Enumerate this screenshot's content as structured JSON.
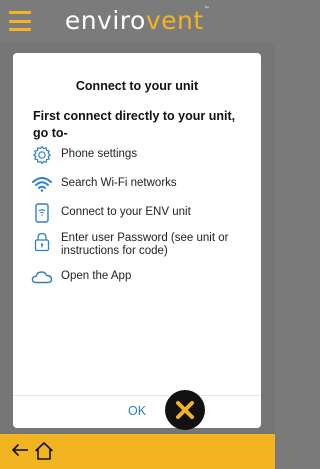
{
  "appbar": {
    "logo_prefix": "enviro",
    "logo_accent": "vent",
    "logo_tm": "™",
    "brand_color": "#f2b521",
    "menu_icon": "hamburger-menu-icon"
  },
  "dialog": {
    "title": "Connect to your unit",
    "subtitle": "First connect directly to your unit, go to-",
    "steps": [
      {
        "icon": "gear-icon",
        "label": "Phone settings"
      },
      {
        "icon": "wifi-icon",
        "label": "Search Wi-Fi networks"
      },
      {
        "icon": "phone-wifi-icon",
        "label": "Connect to your ENV unit"
      },
      {
        "icon": "lock-icon",
        "label": "Enter user Password (see unit or instructions for code)"
      },
      {
        "icon": "cloud-icon",
        "label": "Open the App"
      }
    ],
    "ok_label": "OK",
    "ok_color": "#2f7fc8"
  },
  "close_button": {
    "icon": "close-icon"
  },
  "bottombar": {
    "back_icon": "back-arrow-icon",
    "home_icon": "home-icon"
  }
}
